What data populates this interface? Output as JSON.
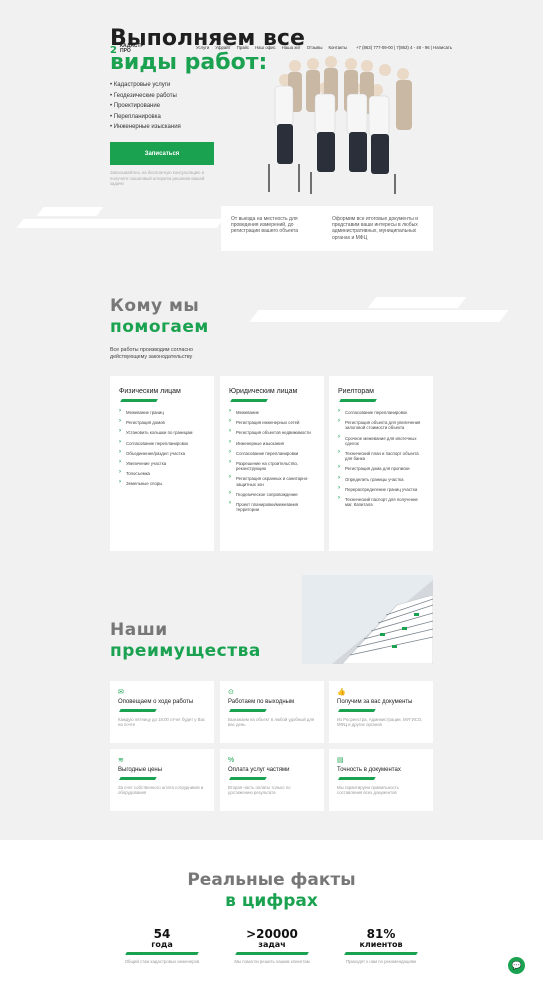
{
  "header": {
    "logo_mark": "2",
    "logo_line1": "КАДАСТР",
    "logo_line2": "ПРО",
    "nav": [
      "Услуги",
      "Уфрайт",
      "Прайс",
      "Наш офис",
      "Наша хит",
      "Отзывы",
      "Контакты"
    ],
    "phone": "+7 (863) 777-09-00 | 7(863) 4 - 48 - 96 | Написать"
  },
  "hero": {
    "title_line1": "Выполняем все",
    "title_line2": "виды работ:",
    "services": [
      "Кадастровые услуги",
      "Геодезические работы",
      "Проектирование",
      "Перепланировка",
      "Инженерные изыскания"
    ],
    "cta_label": "Записаться",
    "cta_note": "Записывайтесь на бесплатную консультацию и получите пошаговый алгоритм решения вашей задачи",
    "info_1": "От выезда на местность для проведения измерений, до регистрации вашего объекта",
    "info_2": "Оформим все итоговые документы и представим ваши интересы в любых административных, муниципальных органах и МФЦ"
  },
  "help": {
    "title_line1": "Кому мы",
    "title_line2": "помогаем",
    "subtitle": "Все работы производим согласно действующему законодательству",
    "cards": [
      {
        "title": "Физическим лицам",
        "items": [
          "Межевание границ",
          "Регистрация домов",
          "Установить кольшки по границам",
          "Согласование перепланировок",
          "Объединение/раздел участка",
          "Увеличение участка",
          "Топосъемка",
          "Земельные споры"
        ]
      },
      {
        "title": "Юридическим лицам",
        "items": [
          "Межевание",
          "Регистрация инженерных сетей",
          "Регистрация объектов недвижимости",
          "Инженерные изыскания",
          "Согласование перепланировки",
          "Разрешение на строительство, реконструкцию",
          "Регистрация охранных и санитарно-защитных зон",
          "Геодезическое сопровождение",
          "Проект планировки/межевания территории"
        ]
      },
      {
        "title": "Риелторам",
        "items": [
          "Согласование перепланировок",
          "Регистрация объекта для увеличения залоговой стоимости объекта",
          "Срочное межевание для ипотечных сделок",
          "Технический план и паспорт объекта для банка",
          "Регистрация дома для прописки",
          "Определить границы участка",
          "Перераспределение границ участка",
          "Технический паспорт для получение маг. Капитала"
        ]
      }
    ]
  },
  "advantages": {
    "title_line1": "Наши",
    "title_line2": "преимущества",
    "cards": [
      {
        "icon": "✉",
        "icon_name": "mail-icon",
        "title": "Оповещаем о ходе работы",
        "text": "Каждую пятницу до 18:00 отчет будет у Вас на почте"
      },
      {
        "icon": "⊙",
        "icon_name": "location-icon",
        "title": "Работаем по выходным",
        "text": "Выезжаем на объект в любой удобный для вас день"
      },
      {
        "icon": "👍",
        "icon_name": "thumbs-up-icon",
        "title": "Получим за вас документы",
        "text": "Из Росреестра, Администрации, МУГИСО, МФЦ и других органов"
      },
      {
        "icon": "≋",
        "icon_name": "coins-icon",
        "title": "Выгодные цены",
        "text": "За счет собственного штата сотрудников и оборудования"
      },
      {
        "icon": "%",
        "icon_name": "percent-icon",
        "title": "Оплата услуг частями",
        "text": "Вторая часть оплаты только по достижению результата"
      },
      {
        "icon": "▤",
        "icon_name": "document-icon",
        "title": "Точность в документах",
        "text": "Мы гарантируем правильность составления всех документов"
      }
    ]
  },
  "facts": {
    "title_line1": "Реальные факты",
    "title_line2": "в цифрах",
    "items": [
      {
        "value": "54",
        "unit": "года",
        "text": "Общий стаж кадастровых инженеров"
      },
      {
        "value": ">20000",
        "unit": "задач",
        "text": "Мы помогли решить нашим клиентам"
      },
      {
        "value": "81%",
        "unit": "клиентов",
        "text": "Приходят к нам по рекомендациям"
      }
    ]
  },
  "chat_icon": "💬"
}
